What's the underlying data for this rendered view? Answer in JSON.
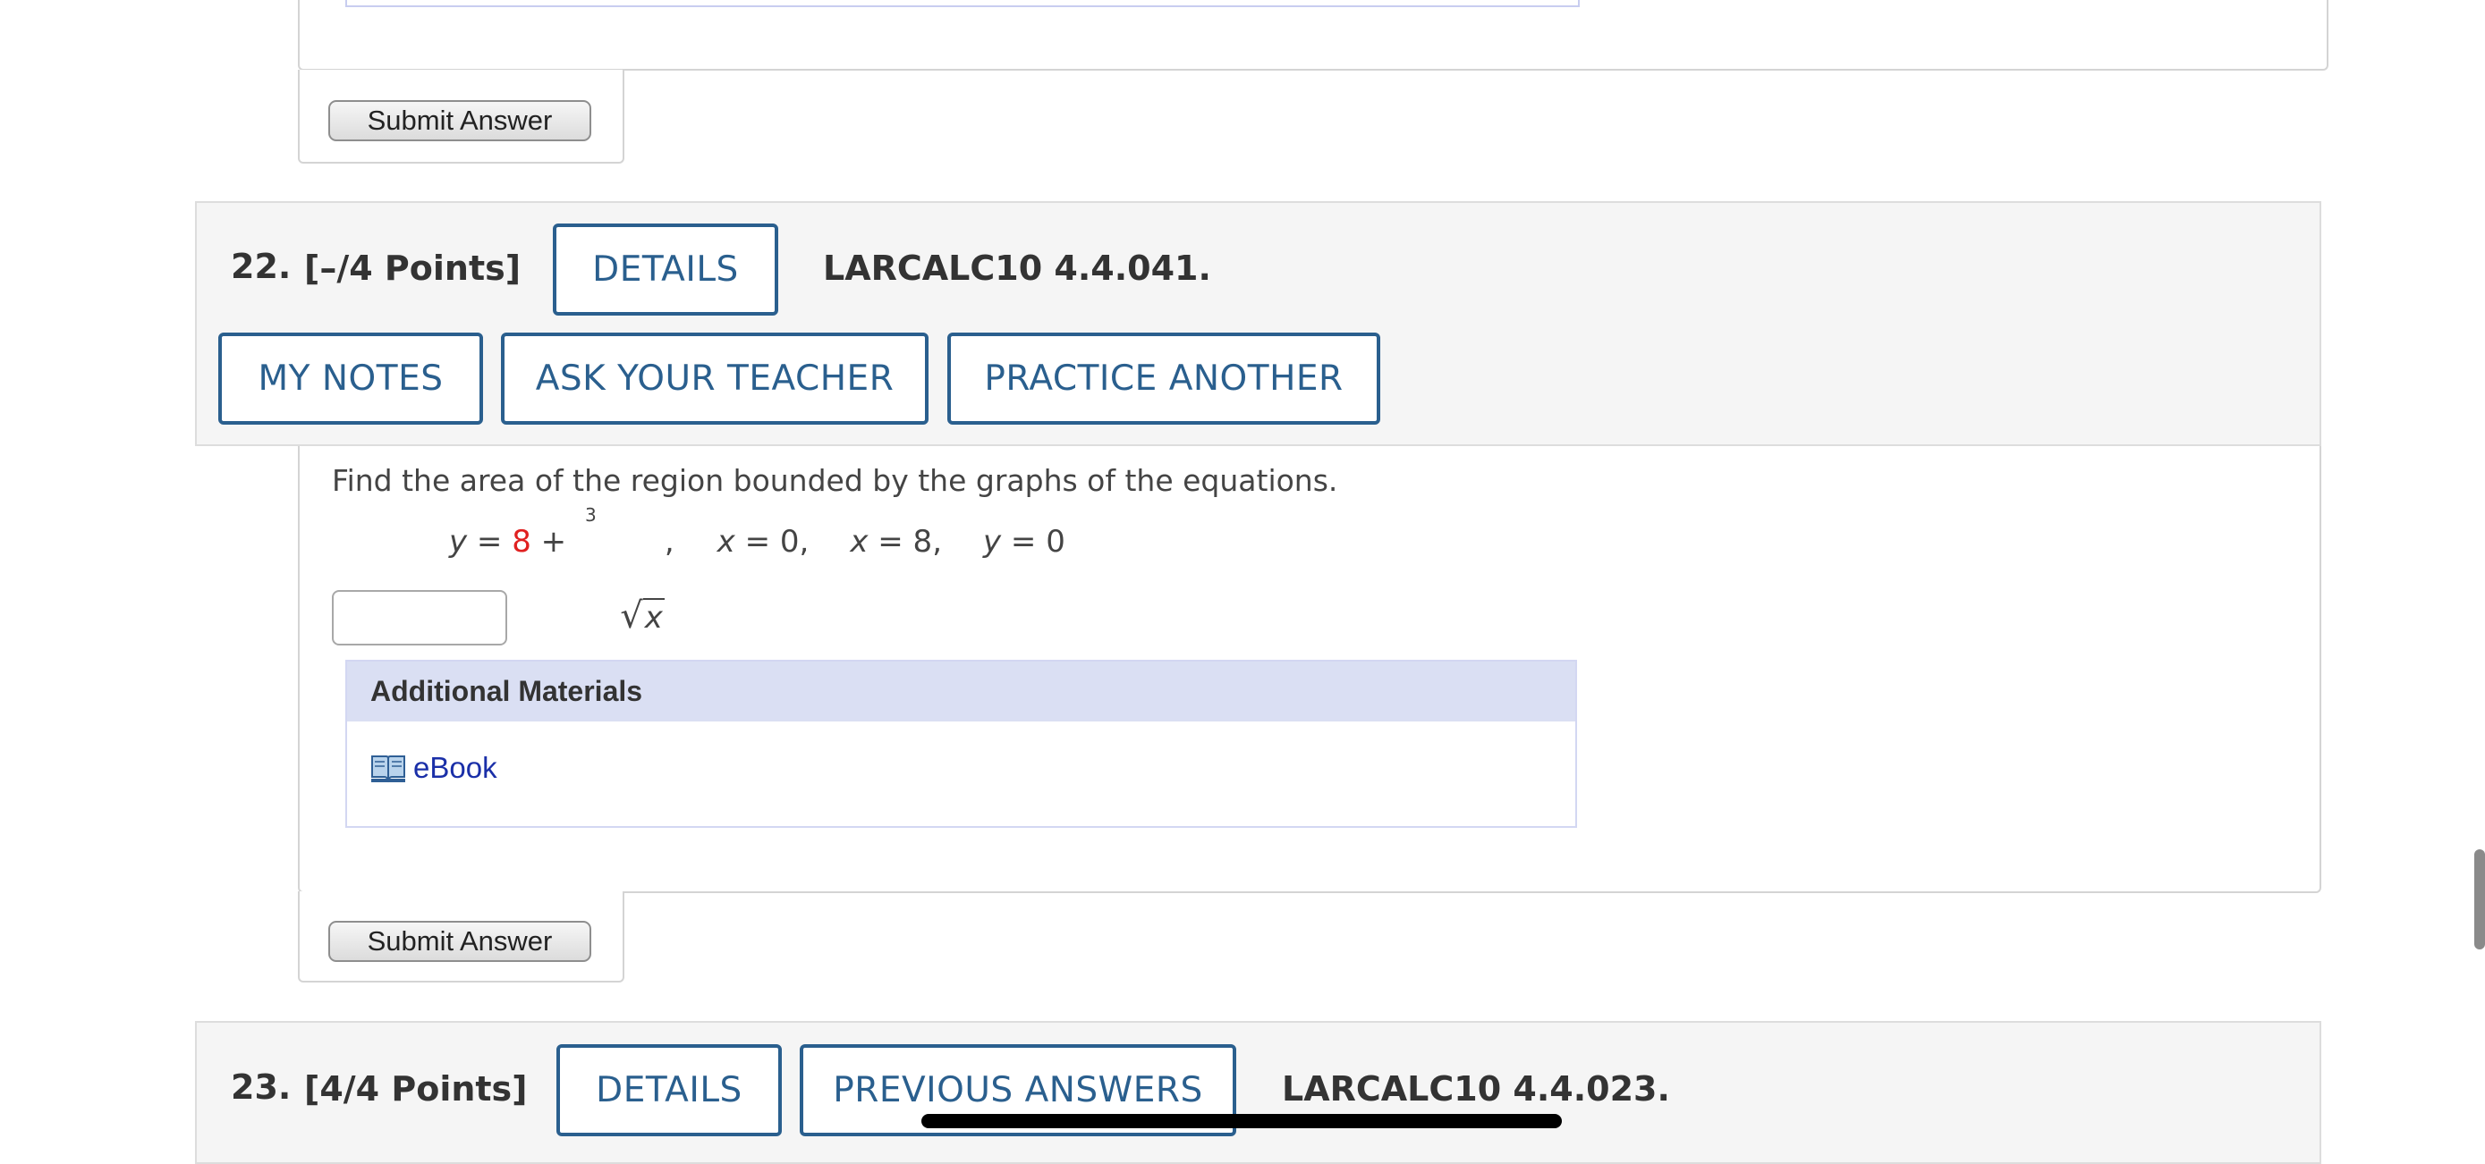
{
  "previous": {
    "submit_label": "Submit Answer"
  },
  "q22": {
    "number": "22.",
    "points": "[–/4 Points]",
    "details_label": "DETAILS",
    "code": "LARCALC10 4.4.041.",
    "my_notes_label": "MY NOTES",
    "ask_teacher_label": "ASK YOUR TEACHER",
    "practice_label": "PRACTICE ANOTHER",
    "prompt": "Find the area of the region bounded by the graphs of the equations.",
    "equation": {
      "y1": "y",
      "eq1": " = ",
      "const": "8",
      "plus": " + ",
      "root_index": "3",
      "root_symbol": "√",
      "root_arg": "x",
      "c1": ",",
      "x0": "x = 0,",
      "x8": "x = 8,",
      "y0": "y = 0"
    },
    "answer_value": "",
    "additional_materials_title": "Additional Materials",
    "ebook_label": "eBook",
    "submit_label": "Submit Answer"
  },
  "q23": {
    "number": "23.",
    "points": "[4/4 Points]",
    "details_label": "DETAILS",
    "previous_answers_label": "PREVIOUS ANSWERS",
    "code": "LARCALC10 4.4.023."
  },
  "colors": {
    "accent_blue": "#2a5f8e",
    "header_bg": "#f5f5f5",
    "materials_bg": "#dadff3",
    "red_value": "#e02020",
    "link_blue": "#1a2fa8"
  },
  "icons": [
    "book-icon"
  ]
}
